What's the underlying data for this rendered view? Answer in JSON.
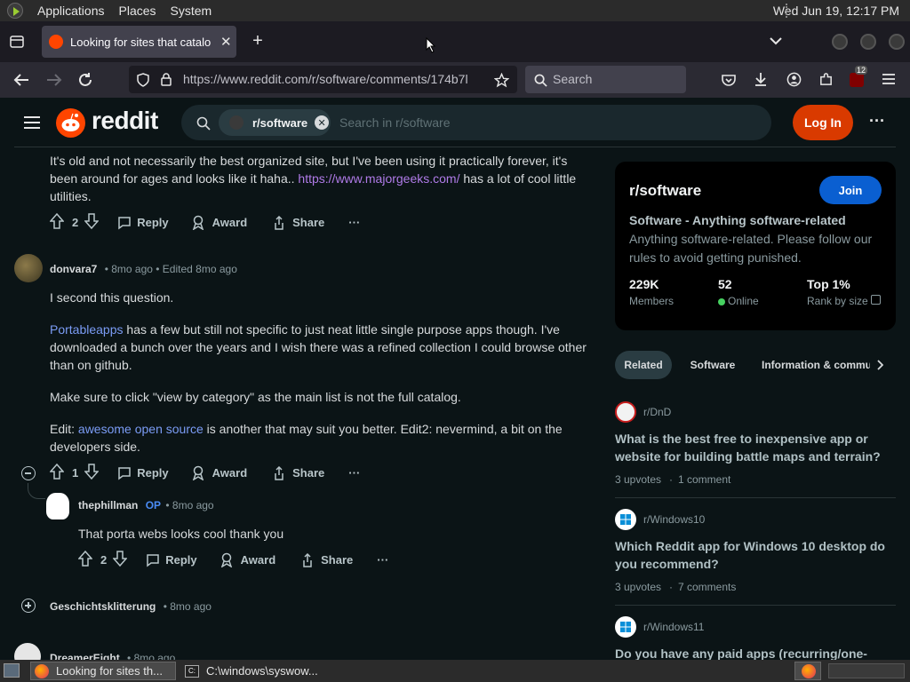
{
  "gnome_panel": {
    "menus": [
      "Applications",
      "Places",
      "System"
    ],
    "clock": "Wed Jun 19, 12:17 PM"
  },
  "browser": {
    "tab_title": "Looking for sites that catalo",
    "url": "https://www.reddit.com/r/software/comments/174b7l",
    "search_placeholder": "Search",
    "extension_badge": "12"
  },
  "reddit_header": {
    "brand": "reddit",
    "search_chip": "r/software",
    "search_placeholder": "Search in r/software",
    "login_label": "Log In",
    "more_label": "···"
  },
  "comments": [
    {
      "text_parts": [
        "It's old and not necessarily the best organized site, but I've been using it practically forever, it's been around for ages and looks like it haha.. ",
        "https://www.majorgeeks.com/",
        " has a lot of cool little utilities."
      ],
      "votes": "2"
    },
    {
      "author": "donvara7",
      "meta": "• 8mo ago • Edited 8mo ago",
      "p1": "I second this question.",
      "p2_link": "Portableapps",
      "p2_text": " has a few but still not specific to just neat little single purpose apps though. I've downloaded a bunch over the years and I wish there was a refined collection I could browse other than on github.",
      "p3": "Make sure to click \"view by category\" as the main list is not the full catalog.",
      "p4_pre": "Edit: ",
      "p4_link": "awesome open source",
      "p4_text": " is another that may suit you better. Edit2: nevermind, a bit on the developers side.",
      "votes": "1"
    },
    {
      "author": "thephillman",
      "op_label": "OP",
      "meta": "• 8mo ago",
      "text": "That porta webs looks cool thank you",
      "votes": "2"
    },
    {
      "author": "Geschichtsklitterung",
      "meta": "• 8mo ago"
    },
    {
      "author": "DreamerEight",
      "meta": "• 8mo ago"
    }
  ],
  "actions": {
    "reply": "Reply",
    "award": "Award",
    "share": "Share",
    "more": "···"
  },
  "sidebar": {
    "name": "r/software",
    "join_label": "Join",
    "tagline": "Software - Anything software-related",
    "description": "Anything software-related. Please follow our rules to avoid getting punished.",
    "stats": [
      {
        "value": "229K",
        "label": "Members"
      },
      {
        "value": "52",
        "label": "Online"
      },
      {
        "value": "Top 1%",
        "label": "Rank by size"
      }
    ],
    "chips": [
      "Related",
      "Software",
      "Information & commu"
    ],
    "related": [
      {
        "sub": "r/DnD",
        "question": "What is the best free to inexpensive app or website for building battle maps and terrain?",
        "upvotes": "3 upvotes",
        "comments": "1 comment"
      },
      {
        "sub": "r/Windows10",
        "question": "Which Reddit app for Windows 10 desktop do you recommend?",
        "upvotes": "3 upvotes",
        "comments": "7 comments"
      },
      {
        "sub": "r/Windows11",
        "question": "Do you have any paid apps (recurring/one-",
        "upvotes": "",
        "comments": ""
      }
    ]
  },
  "taskbar": {
    "tasks": [
      "Looking for sites th...",
      "C:\\windows\\syswow..."
    ]
  },
  "colors": {
    "reddit_orange": "#ff4500",
    "login": "#d93a00",
    "join": "#0a5fd1",
    "link": "#7b9cf5",
    "op": "#4a8cf5",
    "online": "#46d160"
  }
}
